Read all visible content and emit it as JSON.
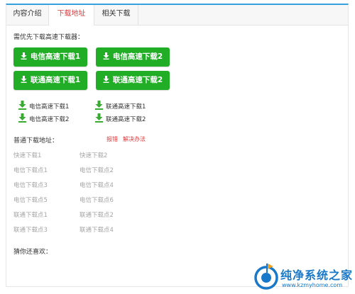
{
  "tabs": [
    {
      "label": "内容介绍"
    },
    {
      "label": "下载地址"
    },
    {
      "label": "相关下载"
    }
  ],
  "prompt": "需优先下载高速下载器：",
  "high_speed_buttons": [
    {
      "label": "电信高速下载1"
    },
    {
      "label": "电信高速下载2"
    },
    {
      "label": "联通高速下载1"
    },
    {
      "label": "联通高速下载2"
    }
  ],
  "small_links": [
    {
      "label": "电信高速下载1"
    },
    {
      "label": "联通高速下载1"
    },
    {
      "label": "电信高速下载2"
    },
    {
      "label": "联通高速下载2"
    }
  ],
  "normal_download": {
    "label": "普通下载地址：",
    "report": "报错",
    "solution": "解决办法"
  },
  "mirrors": [
    [
      "快速下载1",
      "快速下载2"
    ],
    [
      "电信下载点1",
      "电信下载点2"
    ],
    [
      "电信下载点3",
      "电信下载点4"
    ],
    [
      "电信下载点5",
      "电信下载点6"
    ],
    [
      "联通下载点1",
      "联通下载点2"
    ],
    [
      "联通下载点3",
      "联通下载点4"
    ]
  ],
  "recommend_label": "猜你还喜欢：",
  "watermark": {
    "title": "纯净系统之家",
    "url": "www.kzmyhome.com"
  },
  "colors": {
    "accent": "#34a0dc",
    "button_green": "#21ad26",
    "active_tab": "#e4393c",
    "link_red": "#e4393c",
    "muted": "#a5a5a5"
  }
}
